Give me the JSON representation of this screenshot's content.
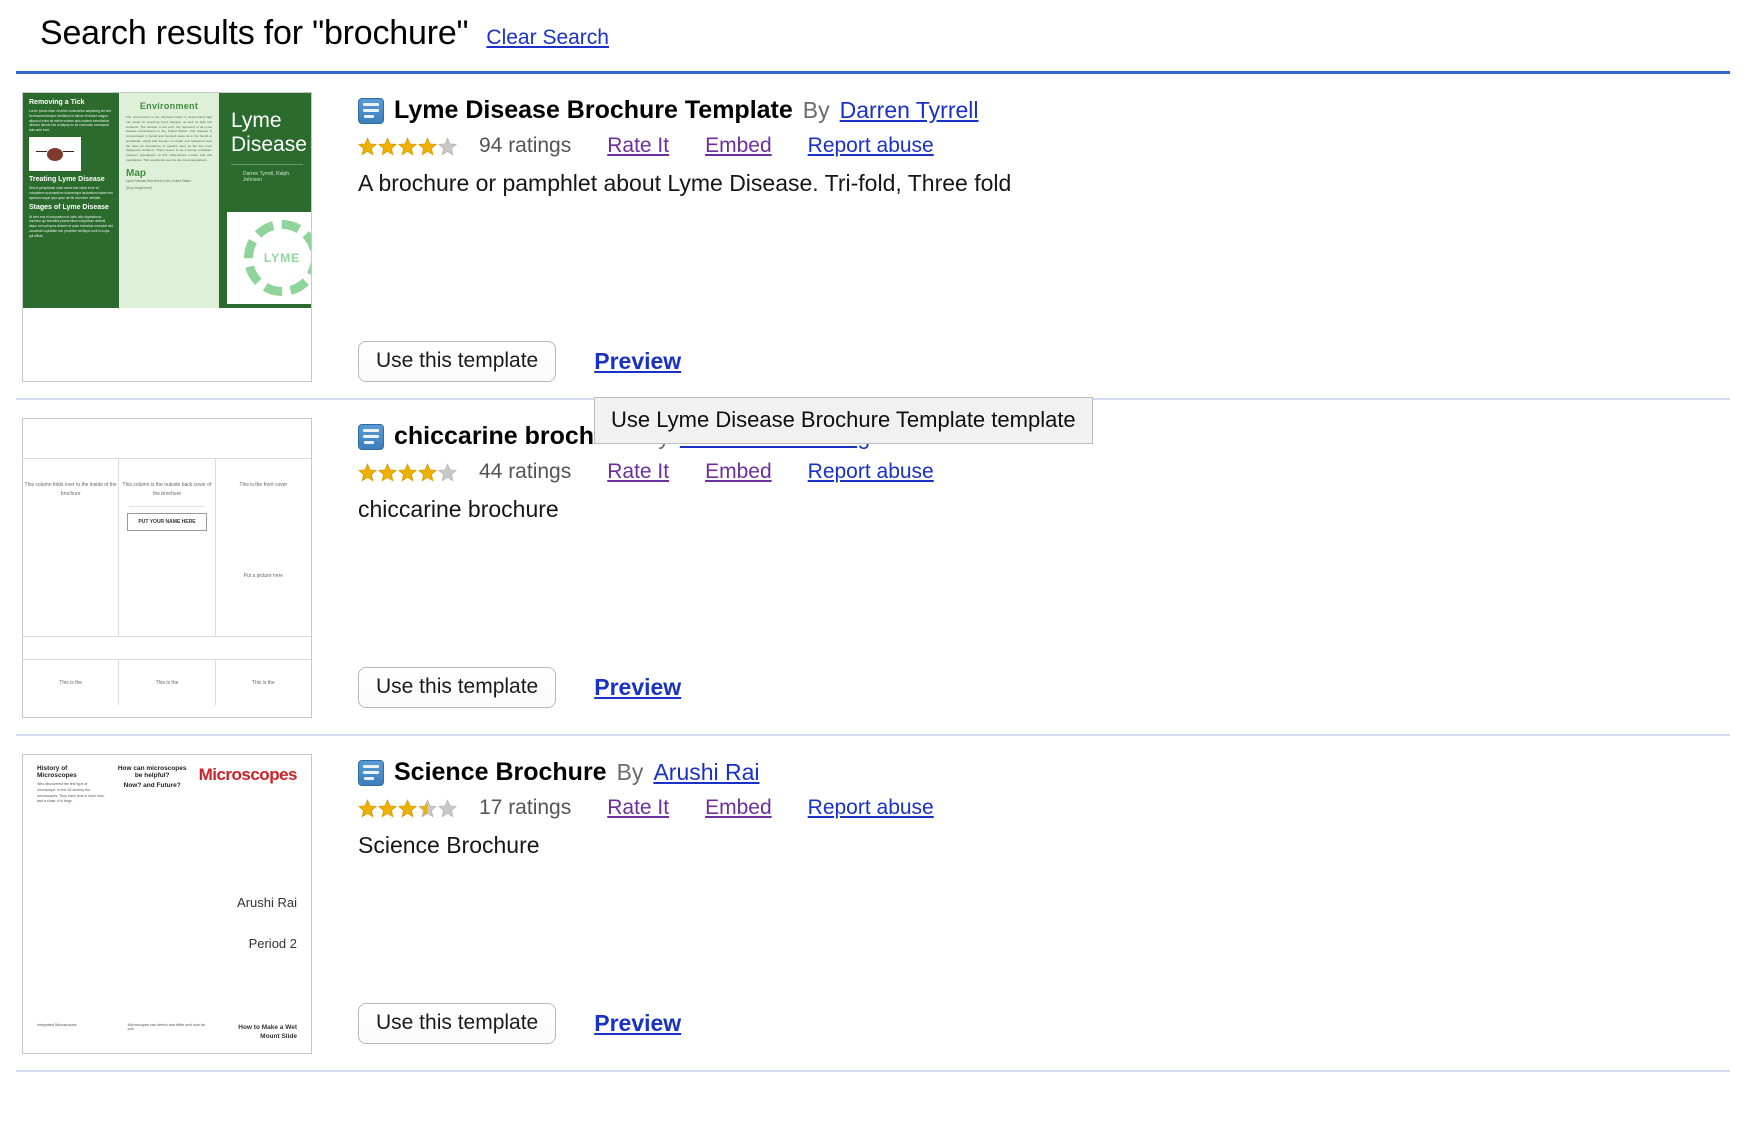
{
  "header": {
    "title": "Search results for \"brochure\"",
    "clear_search_label": "Clear Search",
    "rule_color": "#3367cc"
  },
  "labels": {
    "by": "By",
    "rate_it": "Rate It",
    "embed": "Embed",
    "report_abuse": "Report abuse",
    "use_this_template": "Use this template",
    "preview": "Preview"
  },
  "tooltip": {
    "text": "Use Lyme Disease Brochure Template template"
  },
  "colors": {
    "link_unvisited": "#1a31c8",
    "link_visited": "#6d2f9c",
    "star_filled": "#f0b000",
    "star_empty": "#c9c9c9",
    "separator": "#d3dcef",
    "header_rule": "#3367cc"
  },
  "results": [
    {
      "title": "Lyme Disease Brochure Template",
      "author": "Darren Tyrrell",
      "rating": 4,
      "ratings_count": "94 ratings",
      "description": "A brochure or pamphlet about Lyme Disease. Tri-fold, Three fold",
      "icon": "document-icon",
      "thumbnail": {
        "kind": "lyme-brochure",
        "heading_left": "Removing a Tick",
        "heading_left_2": "Treating Lyme Disease",
        "heading_left_3": "Stages of Lyme Disease",
        "heading_center": "Environment",
        "map_label": "Map",
        "map_sub": "Lyme Disease Risk levels in the United States",
        "map_placeholder": "[Drop Image here]",
        "cover_title": "Lyme Disease",
        "cover_sub": "Darren Tyrrell, Ralph Johnson",
        "seal_text": "LYME"
      }
    },
    {
      "title": "chiccarine brochure",
      "author": "Katherine Dunning",
      "rating": 4,
      "ratings_count": "44 ratings",
      "description": "chiccarine brochure",
      "icon": "document-icon",
      "thumbnail": {
        "kind": "blank-trifold",
        "col1": "This column folds over to the inside of the brochure",
        "col2": "This column is the outside back cover of the brochure",
        "col2_box": "PUT YOUR NAME HERE",
        "col3": "This is the front cover",
        "col3_b": "Put a picture here",
        "foot1": "This is the",
        "foot2": "This is the",
        "foot3": "This is the"
      }
    },
    {
      "title": "Science Brochure",
      "author": "Arushi Rai",
      "rating": 3.5,
      "ratings_count": "17 ratings",
      "description": "Science Brochure",
      "icon": "document-icon",
      "thumbnail": {
        "kind": "science-brochure",
        "col1_head": "History of Microscopes",
        "col1_body": "Who discovered the first type of microscope. In the 16 century the microscopes. They have lens in each lens, and a close, it is large.",
        "col2_head": "How can microscopes be helpful?",
        "col2_sub": "Now? and Future?",
        "cover_title": "Microscopes",
        "cover_name": "Arushi Rai",
        "cover_period": "Period 2",
        "foot1": "Integrated Microscopes",
        "foot2": "Microscopes can detect and differ and how far pull",
        "foot3": "How to Make a Wet Mount Slide"
      }
    }
  ]
}
